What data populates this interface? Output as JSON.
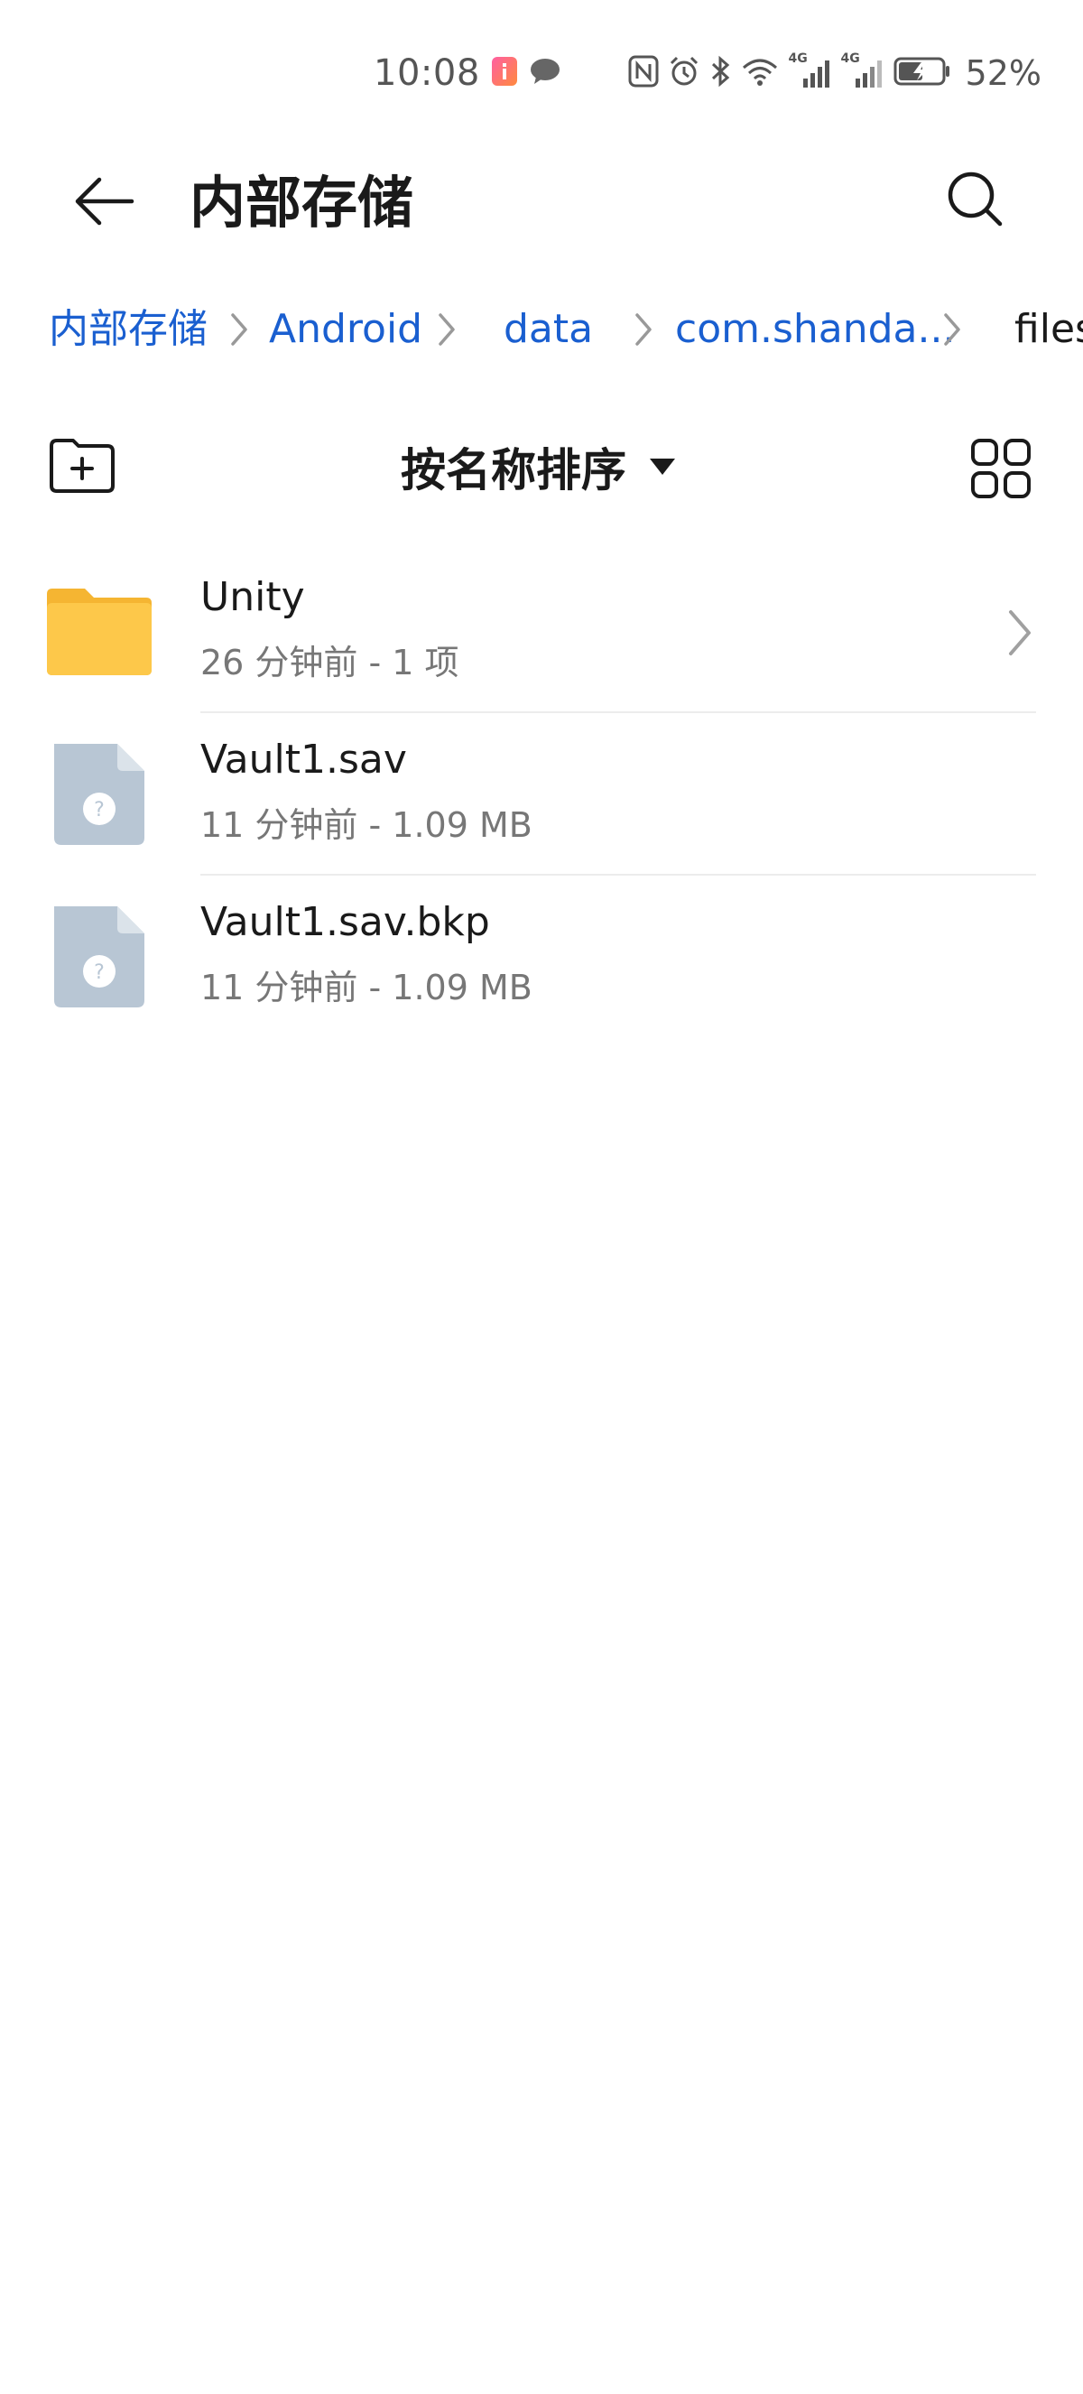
{
  "status_bar": {
    "time": "10:08",
    "battery_percent": "52%",
    "net_label_1": "4G",
    "net_label_2": "4G",
    "icons_left": [
      "app-notification-icon",
      "message-bubble-icon"
    ],
    "icons_right": [
      "nfc-icon",
      "alarm-icon",
      "bluetooth-icon",
      "wifi-icon",
      "signal-4g-icon",
      "signal-4g-icon",
      "battery-charging-icon"
    ]
  },
  "header": {
    "title": "内部存储"
  },
  "breadcrumb": {
    "items": [
      {
        "label": "内部存储"
      },
      {
        "label": "Android"
      },
      {
        "label": "data"
      },
      {
        "label": "com.shanda..."
      },
      {
        "label": "files"
      }
    ]
  },
  "toolbar": {
    "sort_label": "按名称排序",
    "new_folder_icon": "new-folder-icon",
    "sort_icon": "caret-down-icon",
    "view_icon": "grid-view-icon"
  },
  "files": [
    {
      "name": "Unity",
      "meta": "26 分钟前 - 1 项",
      "type": "folder"
    },
    {
      "name": "Vault1.sav",
      "meta": "11 分钟前 - 1.09 MB",
      "type": "unknown-file"
    },
    {
      "name": "Vault1.sav.bkp",
      "meta": "11 分钟前 - 1.09 MB",
      "type": "unknown-file"
    }
  ],
  "colors": {
    "accent": "#1a5fd0",
    "folder": "#fdc84a",
    "unknown_file": "#b8c6d4",
    "text_primary": "#1a1a1a",
    "text_secondary": "#777777"
  }
}
